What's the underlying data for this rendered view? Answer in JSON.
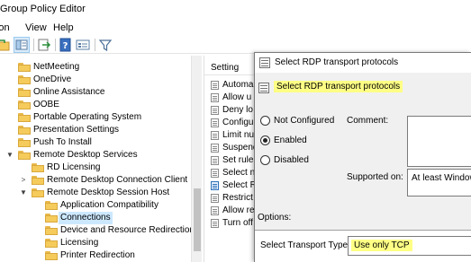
{
  "window": {
    "title": "Group Policy Editor"
  },
  "menu": [
    "Action",
    "View",
    "Help"
  ],
  "tree": {
    "items": [
      {
        "label": "NetMeeting",
        "indent": 0,
        "expander": ""
      },
      {
        "label": "OneDrive",
        "indent": 0,
        "expander": ""
      },
      {
        "label": "Online Assistance",
        "indent": 0,
        "expander": ""
      },
      {
        "label": "OOBE",
        "indent": 0,
        "expander": ""
      },
      {
        "label": "Portable Operating System",
        "indent": 0,
        "expander": ""
      },
      {
        "label": "Presentation Settings",
        "indent": 0,
        "expander": ""
      },
      {
        "label": "Push To Install",
        "indent": 0,
        "expander": ""
      },
      {
        "label": "Remote Desktop Services",
        "indent": 0,
        "expander": "expanded"
      },
      {
        "label": "RD Licensing",
        "indent": 1,
        "expander": ""
      },
      {
        "label": "Remote Desktop Connection Client",
        "indent": 1,
        "expander": "collapsed"
      },
      {
        "label": "Remote Desktop Session Host",
        "indent": 1,
        "expander": "expanded"
      },
      {
        "label": "Application Compatibility",
        "indent": 2,
        "expander": ""
      },
      {
        "label": "Connections",
        "indent": 2,
        "expander": "",
        "selected": true
      },
      {
        "label": "Device and Resource Redirection",
        "indent": 2,
        "expander": ""
      },
      {
        "label": "Licensing",
        "indent": 2,
        "expander": ""
      },
      {
        "label": "Printer Redirection",
        "indent": 2,
        "expander": ""
      }
    ]
  },
  "list": {
    "header": "Setting",
    "rows": [
      {
        "label": "Automa",
        "icon": "setting-icon"
      },
      {
        "label": "Allow u",
        "icon": "setting-icon"
      },
      {
        "label": "Deny lo",
        "icon": "setting-icon"
      },
      {
        "label": "Configu",
        "icon": "setting-icon"
      },
      {
        "label": "Limit nu",
        "icon": "setting-icon"
      },
      {
        "label": "Suspend",
        "icon": "setting-icon"
      },
      {
        "label": "Set rules",
        "icon": "setting-icon"
      },
      {
        "label": "Select ne",
        "icon": "setting-icon"
      },
      {
        "label": "Select RD",
        "icon": "setting-icon-blue"
      },
      {
        "label": "Restrict R",
        "icon": "setting-icon"
      },
      {
        "label": "Allow re",
        "icon": "setting-icon"
      },
      {
        "label": "Turn off",
        "icon": "setting-icon"
      }
    ]
  },
  "dialog": {
    "title": "Select RDP transport protocols",
    "header": "Select RDP transport protocols",
    "radios": [
      {
        "label": "Not Configured",
        "checked": false
      },
      {
        "label": "Enabled",
        "checked": true
      },
      {
        "label": "Disabled",
        "checked": false
      }
    ],
    "comment_label": "Comment:",
    "supported_label": "Supported on:",
    "supported_value": "At least Window",
    "options_label": "Options:",
    "transport_label": "Select Transport Type",
    "transport_value": "Use only TCP"
  },
  "colors": {
    "highlight": "#ffff85",
    "selection": "#cce8ff",
    "folder": "#f5cb5c"
  }
}
